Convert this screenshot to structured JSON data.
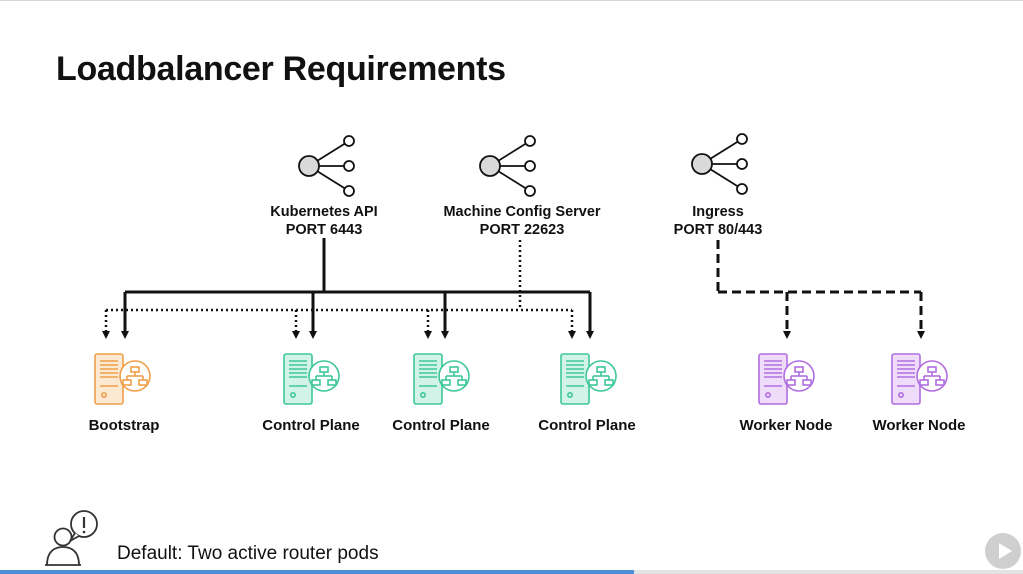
{
  "slide": {
    "title": "Loadbalancer Requirements",
    "note": "Default: Two active router pods",
    "progress_fraction": 0.62
  },
  "loadbalancers": [
    {
      "name": "Kubernetes API",
      "port": "PORT 6443",
      "icon": "share-icon"
    },
    {
      "name": "Machine Config Server",
      "port": "PORT 22623",
      "icon": "share-icon"
    },
    {
      "name": "Ingress",
      "port": "PORT 80/443",
      "icon": "share-icon"
    }
  ],
  "nodes": [
    {
      "label": "Bootstrap",
      "icon": "server-network-icon",
      "color": "#f0a04b"
    },
    {
      "label": "Control Plane",
      "icon": "server-network-icon",
      "color": "#3fc79a"
    },
    {
      "label": "Control Plane",
      "icon": "server-network-icon",
      "color": "#3fc79a"
    },
    {
      "label": "Control Plane",
      "icon": "server-network-icon",
      "color": "#3fc79a"
    },
    {
      "label": "Worker Node",
      "icon": "server-network-icon",
      "color": "#b06ee0"
    },
    {
      "label": "Worker Node",
      "icon": "server-network-icon",
      "color": "#b06ee0"
    }
  ],
  "connections": [
    {
      "from": "Kubernetes API",
      "to": [
        "Bootstrap",
        "Control Plane",
        "Control Plane",
        "Control Plane"
      ],
      "style": "solid"
    },
    {
      "from": "Machine Config Server",
      "to": [
        "Bootstrap",
        "Control Plane",
        "Control Plane",
        "Control Plane"
      ],
      "style": "dotted"
    },
    {
      "from": "Ingress",
      "to": [
        "Worker Node",
        "Worker Node"
      ],
      "style": "dashed"
    }
  ],
  "colors": {
    "text": "#111111",
    "line": "#111111",
    "icon_gray": "#d9d9d9"
  },
  "icons": {
    "note": "person-alert-icon",
    "play": "play-icon"
  }
}
